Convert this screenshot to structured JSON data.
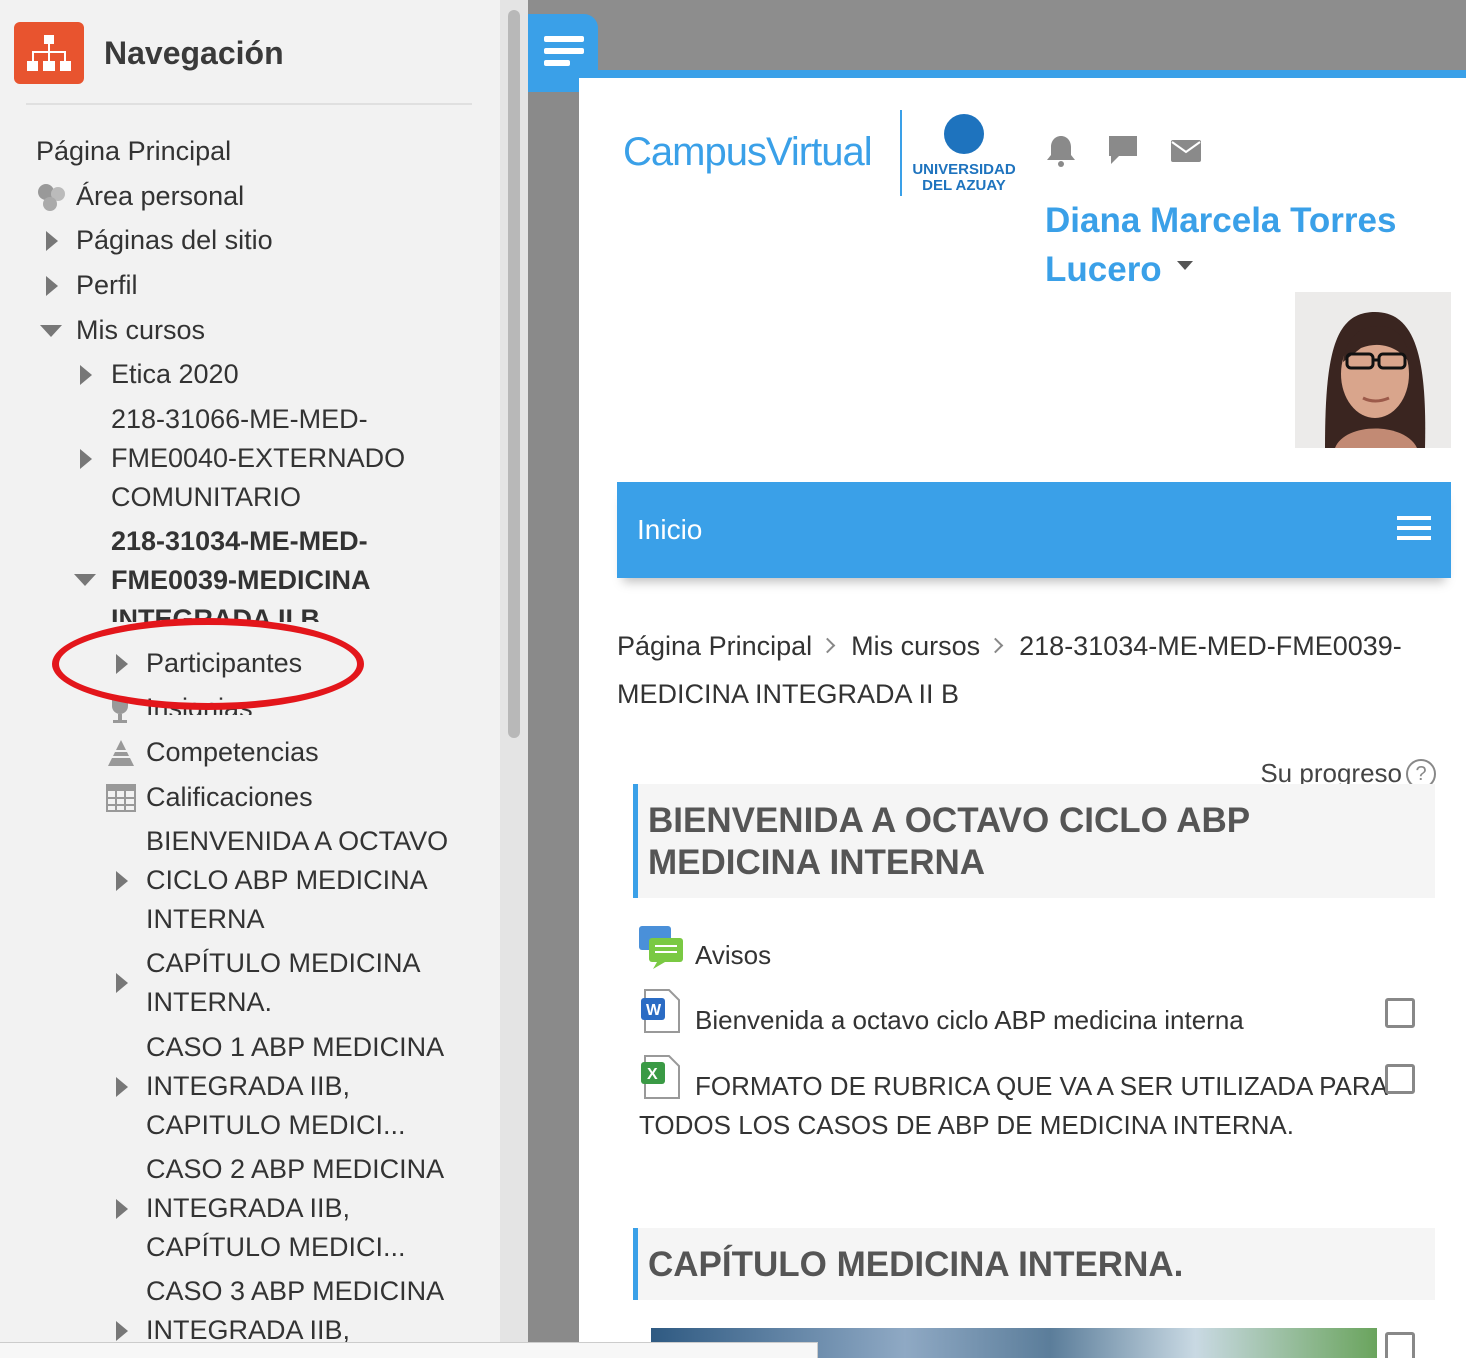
{
  "nav": {
    "title": "Navegación",
    "items": {
      "home": "Página Principal",
      "personal": "Área personal",
      "site_pages": "Páginas del sitio",
      "profile": "Perfil",
      "my_courses": "Mis cursos",
      "ethics": "Etica 2020",
      "course1_l1": "218-31066-ME-MED-",
      "course1_l2": "FME0040-EXTERNADO",
      "course1_l3": "COMUNITARIO",
      "course2_l1": "218-31034-ME-MED-",
      "course2_l2": "FME0039-MEDICINA",
      "course2_l3": "INTEGRADA II B",
      "participants": "Participantes",
      "badges": "Insignias",
      "competencies": "Competencias",
      "grades": "Calificaciones",
      "s1_l1": "BIENVENIDA A OCTAVO",
      "s1_l2": "CICLO ABP MEDICINA",
      "s1_l3": "INTERNA",
      "s2_l1": "CAPÍTULO MEDICINA",
      "s2_l2": "INTERNA.",
      "s3_l1": "CASO 1 ABP MEDICINA",
      "s3_l2": "INTEGRADA IIB,",
      "s3_l3": "CAPITULO MEDICI...",
      "s4_l1": "CASO 2 ABP MEDICINA",
      "s4_l2": "INTEGRADA IIB,",
      "s4_l3": "CAPÍTULO MEDICI...",
      "s5_l1": "CASO 3 ABP MEDICINA",
      "s5_l2": "INTEGRADA IIB,"
    }
  },
  "header": {
    "brand": "CampusVirtual",
    "university_l1": "UNIVERSIDAD",
    "university_l2": "DEL AZUAY",
    "user_name_l1": "Diana Marcela Torres",
    "user_name_l2": "Lucero"
  },
  "inicio": "Inicio",
  "breadcrumb": {
    "home": "Página Principal",
    "courses": "Mis cursos",
    "course_l1": "218-31034-ME-MED-FME0039-",
    "course_l2": "MEDICINA INTEGRADA II B"
  },
  "progress_label": "Su progreso",
  "sections": {
    "welcome_l1": "BIENVENIDA A OCTAVO CICLO ABP",
    "welcome_l2": "MEDICINA INTERNA",
    "chapter": "CAPÍTULO MEDICINA INTERNA."
  },
  "activities": {
    "forum": "Avisos",
    "doc": "Bienvenida a octavo ciclo ABP medicina interna",
    "rubric_l1": "FORMATO DE RUBRICA QUE VA A SER UTILIZADA PARA",
    "rubric_l2": "TODOS LOS CASOS DE ABP DE MEDICINA INTERNA."
  },
  "colors": {
    "accent": "#3aa0e8",
    "nav_logo": "#e8542f",
    "annotation": "#e3161b"
  }
}
